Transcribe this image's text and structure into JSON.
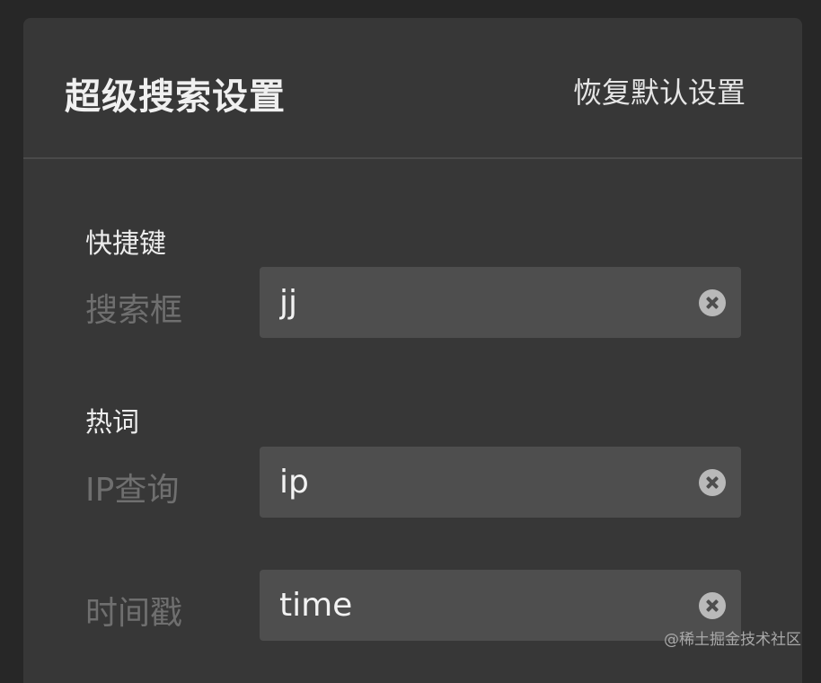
{
  "header": {
    "title": "超级搜索设置",
    "reset_label": "恢复默认设置"
  },
  "sections": [
    {
      "label": "快捷键",
      "fields": [
        {
          "label": "搜索框",
          "value": "jj",
          "clear_icon": "clear-circle-x"
        }
      ]
    },
    {
      "label": "热词",
      "fields": [
        {
          "label": "IP查询",
          "value": "ip",
          "clear_icon": "clear-circle-x"
        },
        {
          "label": "时间戳",
          "value": "time",
          "clear_icon": "clear-circle-x"
        }
      ]
    }
  ],
  "watermark": "@稀土掘金技术社区",
  "colors": {
    "background": "#272727",
    "panel": "#373737",
    "input_bg": "#4e4e4e",
    "label_muted": "#6f6f6f"
  }
}
